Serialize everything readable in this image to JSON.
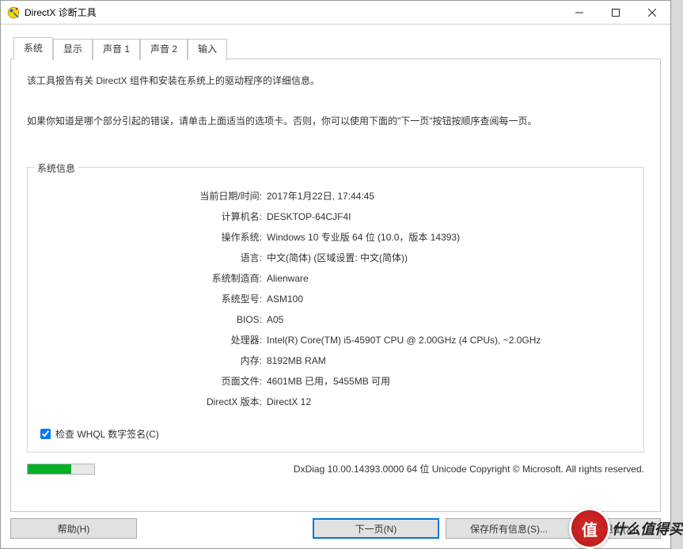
{
  "window": {
    "title": "DirectX 诊断工具"
  },
  "tabs": {
    "system": "系统",
    "display": "显示",
    "sound1": "声音 1",
    "sound2": "声音 2",
    "input": "输入"
  },
  "intro": {
    "line1": "该工具报告有关 DirectX 组件和安装在系统上的驱动程序的详细信息。",
    "line2": "如果你知道是哪个部分引起的错误，请单击上面适当的选项卡。否则，你可以使用下面的\"下一页\"按钮按顺序查阅每一页。"
  },
  "group": {
    "title": "系统信息"
  },
  "fields": {
    "datetime": {
      "label": "当前日期/时间:",
      "value": "2017年1月22日, 17:44:45"
    },
    "computer": {
      "label": "计算机名:",
      "value": "DESKTOP-64CJF4I"
    },
    "os": {
      "label": "操作系统:",
      "value": "Windows 10 专业版 64 位 (10.0，版本 14393)"
    },
    "language": {
      "label": "语言:",
      "value": "中文(简体) (区域设置: 中文(简体))"
    },
    "manufacturer": {
      "label": "系统制造商:",
      "value": "Alienware"
    },
    "model": {
      "label": "系统型号:",
      "value": "ASM100"
    },
    "bios": {
      "label": "BIOS:",
      "value": "A05"
    },
    "processor": {
      "label": "处理器:",
      "value": "Intel(R) Core(TM) i5-4590T CPU @ 2.00GHz (4 CPUs), ~2.0GHz"
    },
    "memory": {
      "label": "内存:",
      "value": "8192MB RAM"
    },
    "pagefile": {
      "label": "页面文件:",
      "value": "4601MB 已用，5455MB 可用"
    },
    "directx": {
      "label": "DirectX 版本:",
      "value": "DirectX 12"
    }
  },
  "checkbox": {
    "whql": "检查 WHQL 数字签名(C)"
  },
  "footer": {
    "copyright": "DxDiag 10.00.14393.0000 64 位 Unicode  Copyright © Microsoft. All rights reserved."
  },
  "buttons": {
    "help": "帮助(H)",
    "next": "下一页(N)",
    "save": "保存所有信息(S)...",
    "exit": "退出(X)"
  },
  "watermark": {
    "badge": "值",
    "text": "什么值得买"
  }
}
